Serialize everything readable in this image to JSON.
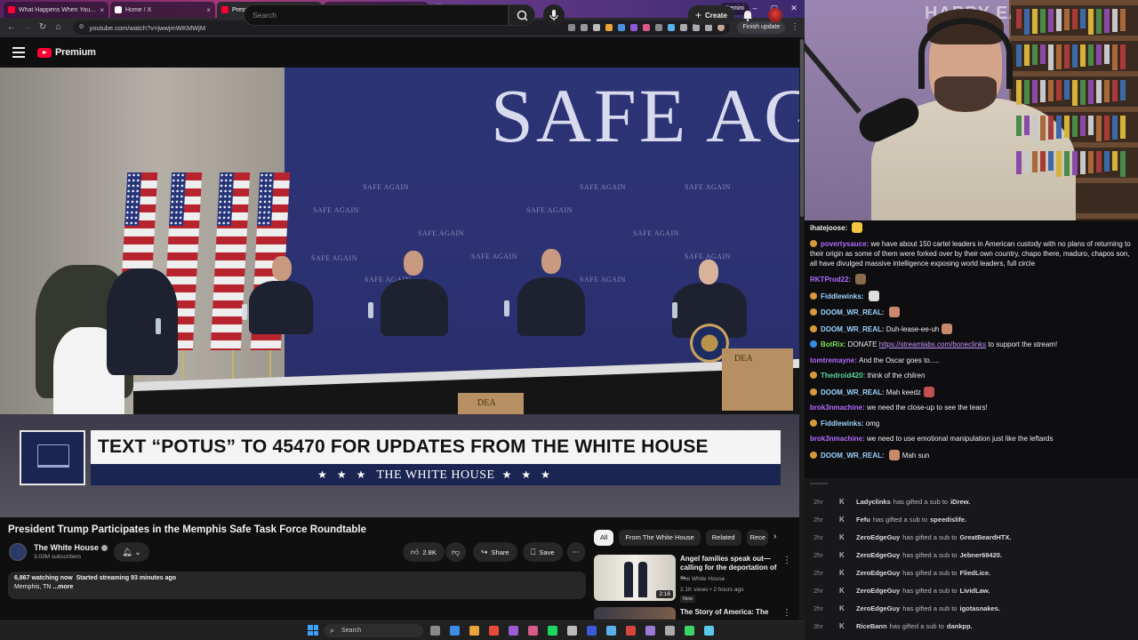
{
  "browser": {
    "tabs": [
      {
        "label": "What Happens When You're A",
        "favicon_color": "#ff0033",
        "active": false
      },
      {
        "label": "Home / X",
        "favicon_color": "#ffffff",
        "active": false
      },
      {
        "label": "President Trump Participat",
        "favicon_color": "#ff0033",
        "active": true
      },
      {
        "label": "Planes & Plates at Proud Bird",
        "favicon_color": "#ff0033",
        "active": false
      }
    ],
    "gemini_label": "Gemini",
    "url": "youtube.com/watch?v=jwwjmWKMWjM",
    "finish_update_label": "Finish update"
  },
  "youtube": {
    "logo_text": "Premium",
    "search_placeholder": "Search",
    "create_label": "Create",
    "video": {
      "banner_text": "SAFE AGA",
      "backdrop_text": "SAFE AGAIN",
      "lower_third_headline": "TEXT “POTUS” TO 45470 FOR UPDATES FROM THE WHITE HOUSE",
      "lower_third_sub": "THE WHITE HOUSE",
      "stars": "★ ★ ★",
      "crate_label": "DEA"
    },
    "title": "President Trump Participates in the Memphis Safe Task Force Roundtable",
    "channel": {
      "name": "The White House",
      "subscribers": "3.03M subscribers"
    },
    "actions": {
      "likes": "2.8K",
      "share": "Share",
      "save": "Save"
    },
    "description": {
      "watching": "6,867 watching now",
      "started": "Started streaming 93 minutes ago",
      "location": "Memphis, TN",
      "more": "...more"
    },
    "chips": [
      "All",
      "From The White House",
      "Related",
      "Rece"
    ],
    "recommendations": [
      {
        "title": "Angel families speak out—calling for the deportation of ...",
        "channel": "The White House",
        "meta": "2.1K views • 2 hours ago",
        "badge": "New",
        "duration": "2:16"
      },
      {
        "title": "The Story of America: The"
      }
    ]
  },
  "taskbar": {
    "search_label": "Search"
  },
  "stream": {
    "overlay_text": "HAPPY EAS",
    "chat": [
      {
        "user": "ihatejoose",
        "color": "#f0f0f0",
        "text": "",
        "badge": "",
        "emote": "#f5c542"
      },
      {
        "user": "povertysauce",
        "color": "#b26bff",
        "text": "we have about 150 cartel leaders in American custody with no plans of returning to their origin as some of them were forked over by their own country, chapo there, maduro, chapos son, all have divulged massive intelligence exposing world leaders, full circle",
        "badge": "#d79a3a",
        "emote": ""
      },
      {
        "user": "RKTProd22",
        "color": "#b26bff",
        "text": "",
        "badge": "",
        "emote": "#8a6a4a"
      },
      {
        "user": "Fiddlewinks",
        "color": "#9ad3ff",
        "text": "",
        "badge": "#d79a3a",
        "emote": "#dddddd"
      },
      {
        "user": "DOOM_WR_REAL",
        "color": "#9ad3ff",
        "text": "",
        "badge": "#d79a3a",
        "emote": "#c78a6a"
      },
      {
        "user": "DOOM_WR_REAL",
        "color": "#9ad3ff",
        "text": "Duh-lease-ee-uh",
        "badge": "#d79a3a",
        "emote": "#c78a6a"
      },
      {
        "user": "BotRix",
        "color": "#7ee05a",
        "text": "DONATE ",
        "link": "https://streamlabs.com/boneclinks",
        "after": " to support the stream!",
        "badge": "#3a8ee6",
        "emote": ""
      },
      {
        "user": "tomtremayne",
        "color": "#b26bff",
        "text": "And the Oscar goes to.....",
        "badge": "",
        "emote": ""
      },
      {
        "user": "Thedroid420",
        "color": "#5ad6a0",
        "text": "think of the chilren",
        "badge": "#d79a3a",
        "emote": ""
      },
      {
        "user": "DOOM_WR_REAL",
        "color": "#9ad3ff",
        "text": "Mah keedz",
        "badge": "#d79a3a",
        "emote": "#c05050"
      },
      {
        "user": "brok3nmachine",
        "color": "#b26bff",
        "text": "we need the close-up to see the tears!",
        "badge": "",
        "emote": ""
      },
      {
        "user": "Fiddlewinks",
        "color": "#9ad3ff",
        "text": "omg",
        "badge": "#d79a3a",
        "emote": ""
      },
      {
        "user": "brok3nmachine",
        "color": "#b26bff",
        "text": "we need to use emotional manipulation just like the leftards",
        "badge": "",
        "emote": ""
      },
      {
        "user": "DOOM_WR_REAL",
        "color": "#9ad3ff",
        "text": "Mah sun",
        "badge": "#d79a3a",
        "emote": "#c78a6a",
        "emote_before": true
      }
    ],
    "events": [
      {
        "time": "2hr",
        "gifter": "Ladyclinks",
        "action": "has gifted a sub to",
        "recipient": "iDrew."
      },
      {
        "time": "2hr",
        "gifter": "Fefu",
        "action": "has gifted a sub to",
        "recipient": "speedislife."
      },
      {
        "time": "2hr",
        "gifter": "ZeroEdgeGuy",
        "action": "has gifted a sub to",
        "recipient": "GreatBeardHTX."
      },
      {
        "time": "2hr",
        "gifter": "ZeroEdgeGuy",
        "action": "has gifted a sub to",
        "recipient": "Jebner69420."
      },
      {
        "time": "2hr",
        "gifter": "ZeroEdgeGuy",
        "action": "has gifted a sub to",
        "recipient": "FliedLice."
      },
      {
        "time": "2hr",
        "gifter": "ZeroEdgeGuy",
        "action": "has gifted a sub to",
        "recipient": "LividLaw."
      },
      {
        "time": "2hr",
        "gifter": "ZeroEdgeGuy",
        "action": "has gifted a sub to",
        "recipient": "igotasnakes."
      },
      {
        "time": "3hr",
        "gifter": "RiceBann",
        "action": "has gifted a sub to",
        "recipient": "dankpp."
      }
    ]
  }
}
